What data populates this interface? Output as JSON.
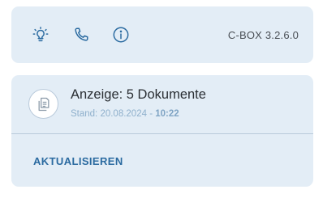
{
  "toolbar": {
    "icons": [
      {
        "name": "lightbulb-icon"
      },
      {
        "name": "phone-icon"
      },
      {
        "name": "info-icon"
      }
    ],
    "version": "C-BOX 3.2.6.0",
    "icon_color": "#2a6aa0"
  },
  "documents": {
    "icon": "documents-icon",
    "title": "Anzeige: 5 Dokumente",
    "stand_prefix": "Stand: 20.08.2024 - ",
    "stand_time": "10:22",
    "refresh_label": "AKTUALISIEREN"
  },
  "colors": {
    "card_background": "#e3edf6",
    "accent": "#2a6aa0",
    "muted_text": "#8fb0cc"
  }
}
